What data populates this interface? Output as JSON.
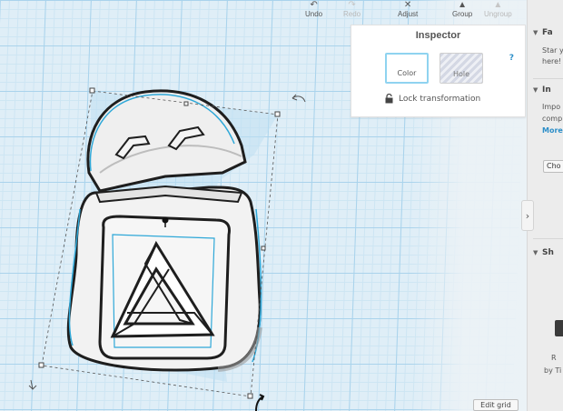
{
  "toolbar": {
    "undo_label": "Undo",
    "redo_label": "Redo",
    "adjust_label": "Adjust",
    "group_label": "Group",
    "ungroup_label": "Ungroup"
  },
  "inspector": {
    "title": "Inspector",
    "help": "?",
    "color_label": "Color",
    "hole_label": "Hole",
    "lock_label": "Lock transformation"
  },
  "side_panel": {
    "section1_heading": "Fa",
    "section1_line1": "Star yo",
    "section1_line2": "here!",
    "section2_heading": "In",
    "section2_line1": "Impo",
    "section2_line2": "comp",
    "section2_more": "More",
    "choose_label": "Cho",
    "section3_heading": "Sh",
    "by_text": "by Ti",
    "r_text": "R",
    "collapse_icon": "›"
  },
  "edit_grid_label": "Edit grid",
  "colors": {
    "selection_outline": "#2fa8d8",
    "grid_major": "#a9d3ec",
    "grid_minor": "#cde5f3",
    "workplane_bg": "#dfeef7",
    "panel_bg": "#ececec"
  }
}
